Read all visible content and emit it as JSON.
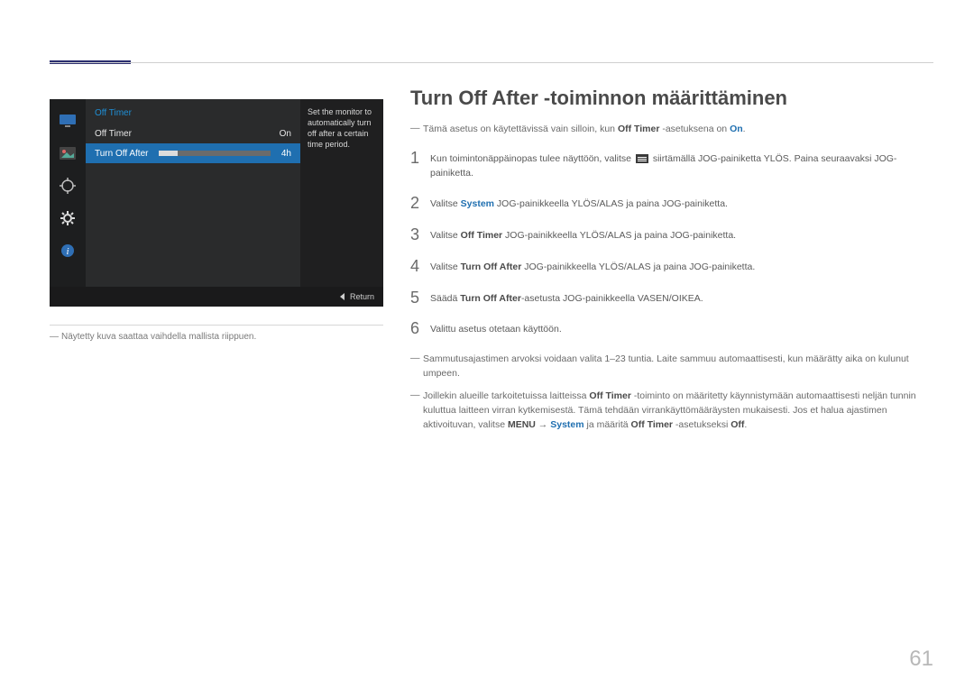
{
  "page_number": "61",
  "osd": {
    "title": "Off Timer",
    "rows": [
      {
        "label": "Off Timer",
        "value": "On"
      },
      {
        "label": "Turn Off After",
        "value": "4h"
      }
    ],
    "help_text": "Set the monitor to automatically turn off after a certain time period.",
    "return_label": "Return"
  },
  "osd_caption": "Näytetty kuva saattaa vaihdella mallista riippuen.",
  "heading": "Turn Off After -toiminnon määrittäminen",
  "intro_note": {
    "pre": "Tämä asetus on käytettävissä vain silloin, kun ",
    "bold1": "Off Timer",
    "mid": " -asetuksena on ",
    "blue": "On",
    "post": "."
  },
  "steps": [
    {
      "num": "1",
      "pre": "Kun toimintonäppäinopas tulee näyttöön, valitse ",
      "post": " siirtämällä JOG-painiketta YLÖS. Paina seuraavaksi JOG-painiketta.",
      "has_icon": true
    },
    {
      "num": "2",
      "pre": "Valitse ",
      "blue": "System",
      "post": " JOG-painikkeella YLÖS/ALAS ja paina JOG-painiketta."
    },
    {
      "num": "3",
      "pre": "Valitse ",
      "bold": "Off Timer",
      "post": " JOG-painikkeella YLÖS/ALAS ja paina JOG-painiketta."
    },
    {
      "num": "4",
      "pre": "Valitse ",
      "bold": "Turn Off After",
      "post": " JOG-painikkeella YLÖS/ALAS ja paina JOG-painiketta."
    },
    {
      "num": "5",
      "pre": "Säädä ",
      "bold": "Turn Off After",
      "post": "-asetusta JOG-painikkeella VASEN/OIKEA."
    },
    {
      "num": "6",
      "pre": "Valittu asetus otetaan käyttöön."
    }
  ],
  "footnotes": [
    {
      "text": "Sammutusajastimen arvoksi voidaan valita 1–23 tuntia. Laite sammuu automaattisesti, kun määrätty aika on kulunut umpeen."
    },
    {
      "p1": "Joillekin alueille tarkoitetuissa laitteissa ",
      "b1": "Off Timer",
      "p2": " -toiminto on määritetty käynnistymään automaattisesti neljän tunnin kuluttua laitteen virran kytkemisestä. Tämä tehdään virrankäyttömääräysten mukaisesti. Jos et halua ajastimen aktivoituvan, valitse ",
      "b2": "MENU",
      "arrow": " → ",
      "blue": "System",
      "p3": " ja määritä ",
      "b3": "Off Timer",
      "p4": " -asetukseksi ",
      "b4": "Off",
      "p5": "."
    }
  ]
}
